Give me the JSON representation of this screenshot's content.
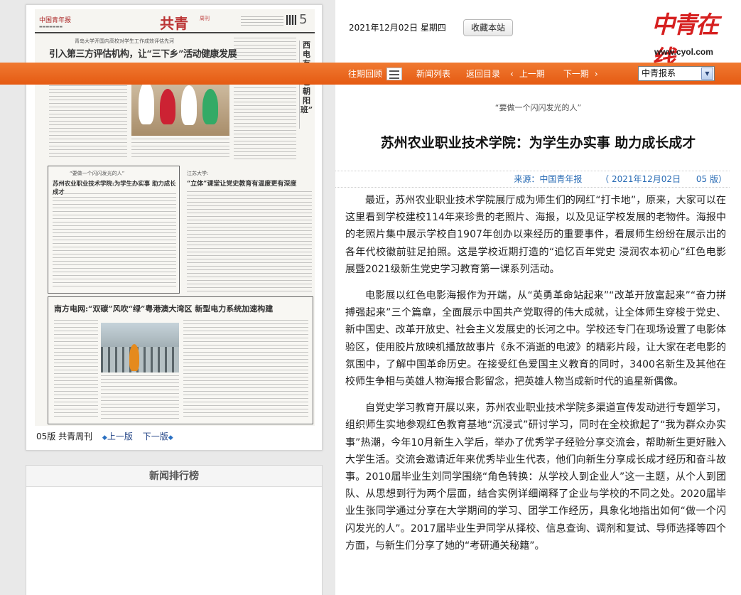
{
  "header": {
    "date": "2021年12月02日 星期四",
    "bookmark_label": "收藏本站",
    "logo_text": "中青在线",
    "logo_url": "www.cyol.com"
  },
  "nav": {
    "items": [
      "往期回顾",
      "新闻列表",
      "返回目录",
      "上一期",
      "下一期"
    ],
    "prev_arrow": "‹",
    "next_arrow": "›",
    "select_value": "中青报系"
  },
  "paper": {
    "masthead": "中国青年报",
    "section": "共青",
    "section_sub": "周刊",
    "page_no": "5",
    "story1_kicker": "青岛大学开国内高校对学生工作成效评估先河",
    "story1_head": "引入第三方评估机构，让“三下乡”活动健康发展",
    "vertical_head": "西电有个“红色朝阳班”",
    "story2_kicker": "“要做一个闪闪发光的人”",
    "story2_head": "苏州农业职业技术学院:为学生办实事 助力成长成才",
    "story3_kicker": "江苏大学:",
    "story3_head": "“立体”课堂让党史教育有温度更有深度",
    "story4_head": "南方电网:“双碳”风吹“绿”粤港澳大湾区 新型电力系统加速构建"
  },
  "paper_footer": {
    "label": "05版 共青周刊",
    "prev": "上一版",
    "next": "下一版",
    "prev_arrow": "◆",
    "next_arrow": "◆"
  },
  "ranking": {
    "title": "新闻排行榜"
  },
  "article": {
    "kicker": "“要做一个闪闪发光的人”",
    "title": "苏州农业职业技术学院：为学生办实事 助力成长成才",
    "source": "来源：中国青年报",
    "date": "（ 2021年12月02日",
    "page": "05 版）",
    "paragraphs": [
      "最近，苏州农业职业技术学院展厅成为师生们的网红“打卡地”，原来，大家可以在这里看到学校建校114年来珍贵的老照片、海报，以及见证学校发展的老物件。海报中的老照片集中展示学校自1907年创办以来经历的重要事件，看展师生纷纷在展示出的各年代校徽前驻足拍照。这是学校近期打造的“追忆百年党史 浸润农本初心”红色电影展暨2021级新生党史学习教育第一课系列活动。",
      "电影展以红色电影海报作为开端，从“英勇革命站起来”“改革开放富起来”“奋力拼搏强起来”三个篇章，全面展示中国共产党取得的伟大成就，让全体师生穿梭于党史、新中国史、改革开放史、社会主义发展史的长河之中。学校还专门在现场设置了电影体验区，使用胶片放映机播放故事片《永不消逝的电波》的精彩片段，让大家在老电影的氛围中，了解中国革命历史。在接受红色爱国主义教育的同时，3400名新生及其他在校师生争相与英雄人物海报合影留念，把英雄人物当成新时代的追星新偶像。",
      "自党史学习教育开展以来，苏州农业职业技术学院多渠道宣传发动进行专题学习，组织师生实地参观红色教育基地“沉浸式”研讨学习，同时在全校掀起了“我为群众办实事”热潮，今年10月新生入学后，举办了优秀学子经验分享交流会，帮助新生更好融入大学生活。交流会邀请近年来优秀毕业生代表，他们向新生分享成长成才经历和奋斗故事。2010届毕业生刘同学围绕“角色转换：从学校人到企业人”这一主题，从个人到团队、从思想到行为两个层面，结合实例详细阐释了企业与学校的不同之处。2020届毕业生张同学通过分享在大学期间的学习、团学工作经历，具象化地指出如何“做一个闪闪发光的人”。2017届毕业生尹同学从择校、信息查询、调剂和复试、导师选择等四个方面，与新生们分享了她的“考研通关秘籍”。"
    ]
  }
}
